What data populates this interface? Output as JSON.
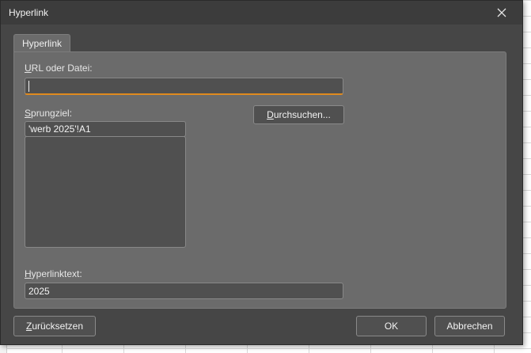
{
  "dialog": {
    "title": "Hyperlink",
    "close_glyph": "✕"
  },
  "tab": {
    "label": "Hyperlink"
  },
  "url_field": {
    "label_accel": "U",
    "label_rest": "RL oder Datei:",
    "value": ""
  },
  "target_field": {
    "label_accel": "S",
    "label_rest": "prungziel:",
    "value": "'werb 2025'!A1"
  },
  "browse_button": {
    "label_accel": "D",
    "label_rest": "urchsuchen..."
  },
  "linktext_field": {
    "label_accel": "H",
    "label_rest": "yperlinktext:",
    "value": "2025"
  },
  "footer": {
    "reset_accel": "Z",
    "reset_rest": "urücksetzen",
    "ok_label": "OK",
    "cancel_label": "Abbrechen"
  },
  "colors": {
    "focus_accent": "#e08a1e",
    "dialog_bg": "#464646",
    "panel_bg": "#6b6b6b"
  }
}
